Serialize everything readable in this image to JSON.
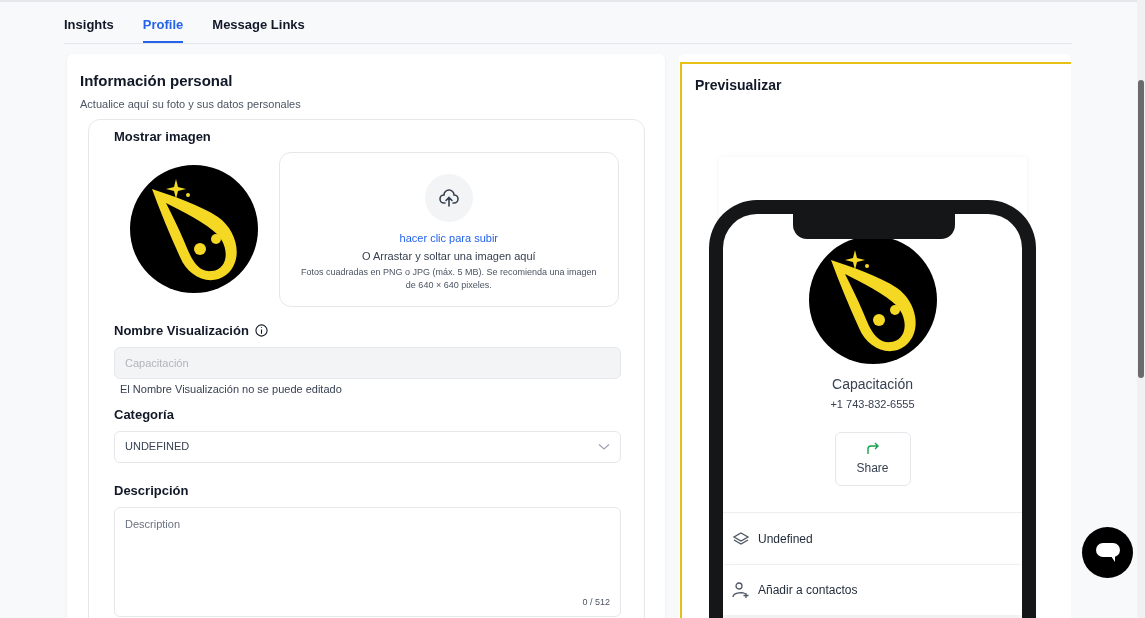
{
  "tabs": [
    {
      "label": "Insights",
      "selected": false
    },
    {
      "label": "Profile",
      "selected": true
    },
    {
      "label": "Message Links",
      "selected": false
    }
  ],
  "personal_info": {
    "title": "Información personal",
    "subtitle": "Actualice aquí su foto y sus datos personales",
    "image_section": {
      "label": "Mostrar imagen",
      "upload_link": "hacer clic para subir",
      "upload_text": "O Arrastar y soltar una imagen aquí",
      "upload_hint": "Fotos cuadradas en PNG o JPG (máx. 5 MB). Se recomienda una imagen de 640 × 640 pixeles."
    },
    "display_name": {
      "label": "Nombre Visualización",
      "placeholder": "Capacitación",
      "disabled": true,
      "note": "El Nombre Visualización no se puede editado"
    },
    "category": {
      "label": "Categoría",
      "value": "UNDEFINED"
    },
    "description": {
      "label": "Descripción",
      "placeholder": "Description",
      "counter": "0 / 512"
    }
  },
  "preview": {
    "title": "Previsualizar",
    "name": "Capacitación",
    "phone": "+1 743-832-6555",
    "share_button": "Share",
    "items": [
      {
        "kind": "category",
        "label": "Undefined"
      },
      {
        "kind": "contact",
        "label": "Añadir a contactos"
      }
    ]
  }
}
